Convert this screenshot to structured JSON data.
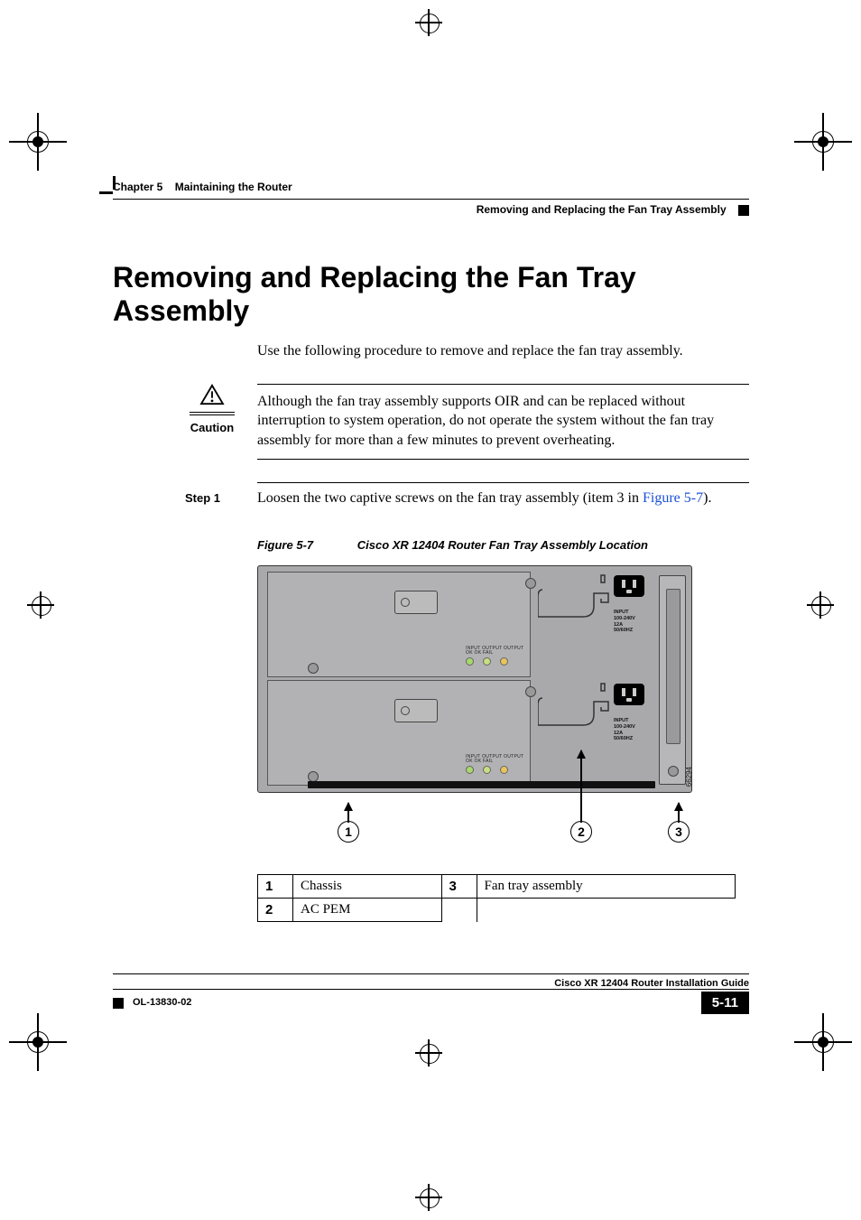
{
  "header": {
    "chapter": "Chapter 5",
    "chapter_title": "Maintaining the Router",
    "section": "Removing and Replacing the Fan Tray Assembly"
  },
  "title": "Removing and Replacing the Fan Tray Assembly",
  "intro": "Use the following procedure to remove and replace the fan tray assembly.",
  "caution": {
    "label": "Caution",
    "text": "Although the fan tray assembly supports OIR and can be replaced without interruption to system operation, do not operate the system without the fan tray assembly for more than a few minutes to prevent overheating."
  },
  "step1": {
    "label": "Step 1",
    "text_before": "Loosen the two captive screws on the fan tray assembly (item 3 in ",
    "link": "Figure 5-7",
    "text_after": ")."
  },
  "figure": {
    "number": "Figure 5-7",
    "caption": "Cisco XR 12404 Router Fan Tray Assembly Location",
    "led_labels": "INPUT  OUTPUT OUTPUT",
    "led_labels2": "OK      OK      FAIL",
    "power_spec": "INPUT\n100-240V\n12A\n50/60HZ",
    "art_number": "66294",
    "callouts": {
      "c1": "1",
      "c2": "2",
      "c3": "3"
    }
  },
  "legend": {
    "r1n": "1",
    "r1t": "Chassis",
    "r2n": "3",
    "r2t": "Fan tray assembly",
    "r3n": "2",
    "r3t": "AC PEM"
  },
  "footer": {
    "guide": "Cisco XR 12404 Router Installation Guide",
    "doc": "OL-13830-02",
    "page": "5-11"
  }
}
